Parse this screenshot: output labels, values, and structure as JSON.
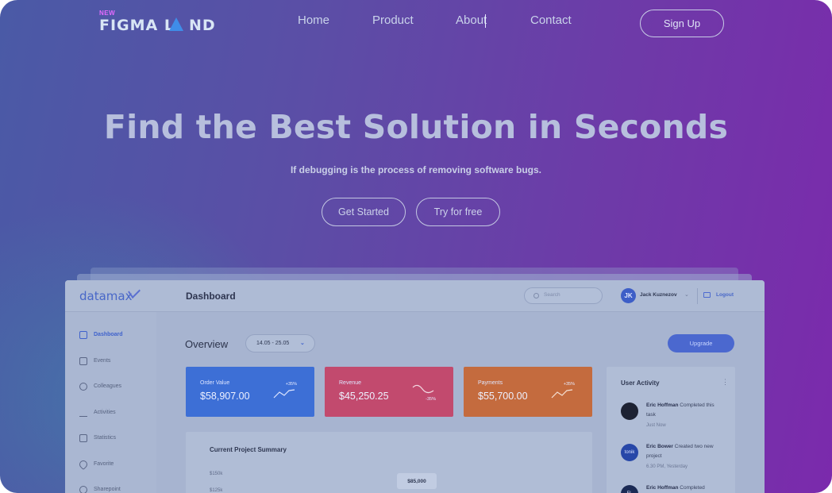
{
  "nav": {
    "logo_badge": "NEW",
    "logo_text_a": "FIGMA L",
    "logo_text_b": "ND",
    "links": [
      "Home",
      "Product",
      "About",
      "Contact"
    ],
    "signup": "Sign Up"
  },
  "hero": {
    "title": "Find the Best Solution in Seconds",
    "subtitle": "If debugging is the process of removing software bugs.",
    "primary_button": "Get Started",
    "secondary_button": "Try for free"
  },
  "dashboard": {
    "brand": "datamax",
    "title": "Dashboard",
    "search_placeholder": "Search",
    "user_initial": "JK",
    "user_name": "Jack Kuznezov",
    "logout": "Logout",
    "sidebar": [
      "Dashboard",
      "Events",
      "Colleagues",
      "Activities",
      "Statistics",
      "Favorite",
      "Sharepoint"
    ],
    "overview": "Overview",
    "date_range": "14.05 - 25.05",
    "upgrade": "Upgrade",
    "cards": [
      {
        "title": "Order Value",
        "value": "$58,907.00",
        "pct": "+35%",
        "color": "#3d6fd6"
      },
      {
        "title": "Revenue",
        "value": "$45,250.25",
        "pct": "-35%",
        "color": "#c24a6e"
      },
      {
        "title": "Payments",
        "value": "$55,700.00",
        "pct": "+35%",
        "color": "#c46b3e"
      }
    ],
    "activity": {
      "title": "User Activity",
      "items": [
        {
          "name": "Eric Hoffman",
          "text": "Completed this task",
          "time": "Just Now",
          "avatar": ""
        },
        {
          "name": "Eric Bower",
          "text": "Created two new project",
          "time": "6.30 PM, Yesterday",
          "avatar": "tonik"
        },
        {
          "name": "Eric Hoffman",
          "text": "Completed",
          "time": "",
          "avatar": "FL"
        }
      ]
    },
    "summary": {
      "title": "Current Project Summary",
      "y_ticks": [
        "$150k",
        "$125k"
      ],
      "tooltip": "$85,000"
    }
  },
  "colors": {
    "accent": "#4867c8",
    "bg_start": "#4a5aa6",
    "bg_end": "#7b2aac"
  }
}
